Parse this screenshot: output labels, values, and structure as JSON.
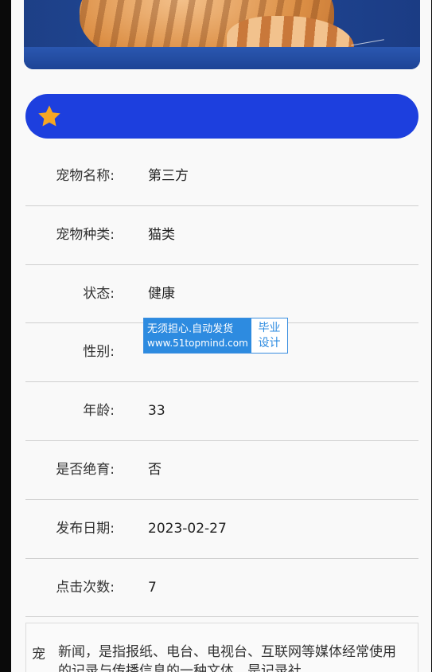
{
  "banner": {
    "icon": "star-icon",
    "accent": "#1d3fde",
    "star_color": "#f5a623"
  },
  "details": [
    {
      "label": "宠物名称:",
      "value": "第三方"
    },
    {
      "label": "宠物种类:",
      "value": "猫类"
    },
    {
      "label": "状态:",
      "value": "健康"
    },
    {
      "label": "性别:",
      "value": ""
    },
    {
      "label": "年龄:",
      "value": "33"
    },
    {
      "label": "是否绝育:",
      "value": "否"
    },
    {
      "label": "发布日期:",
      "value": "2023-02-27"
    },
    {
      "label": "点击次数:",
      "value": "7"
    }
  ],
  "description": {
    "label": "宠",
    "text": "新闻，是指报纸、电台、电视台、互联网等媒体经常使用的记录与传播信息的一种文体，是记录社"
  },
  "watermark": {
    "line1": "无须担心.自动发货",
    "line2": "www.51topmind.com",
    "right1": "毕业",
    "right2": "设计"
  }
}
